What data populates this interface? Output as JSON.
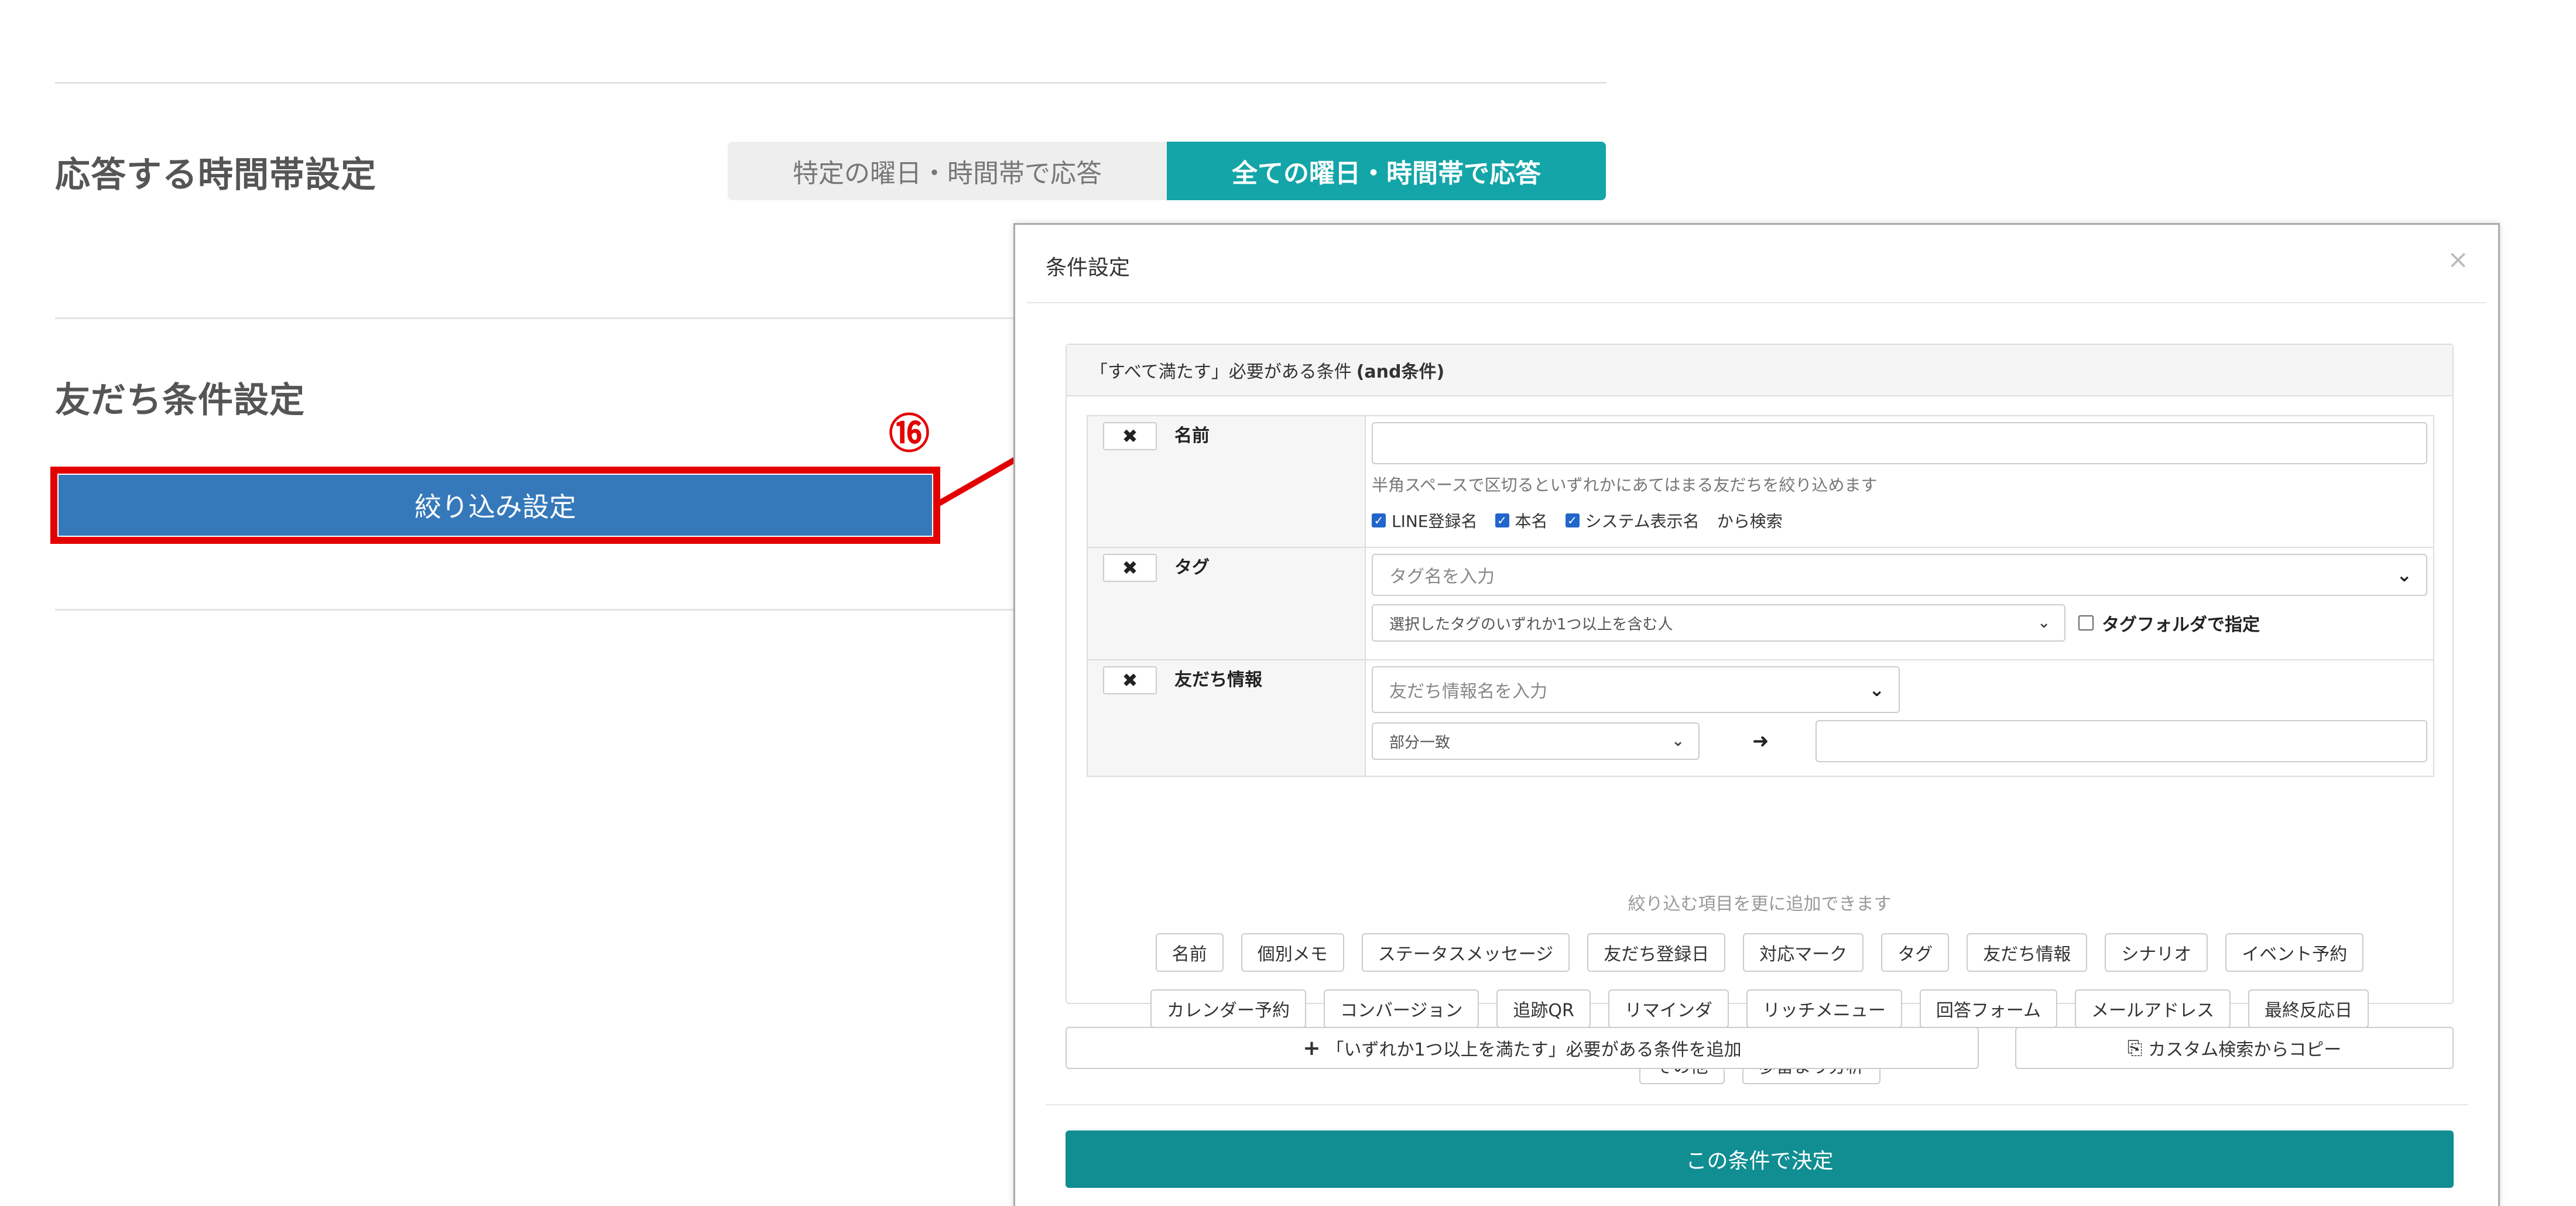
{
  "time_section": {
    "title": "応答する時間帯設定",
    "option_specific": "特定の曜日・時間帯で応答",
    "option_all": "全ての曜日・時間帯で応答"
  },
  "friend_section": {
    "title": "友だち条件設定",
    "filter_button": "絞り込み設定"
  },
  "annotation": {
    "step": "⑯"
  },
  "modal": {
    "title": "条件設定",
    "close": "×",
    "panel_head": "「すべて満たす」必要がある条件",
    "panel_head_bold": "(and条件)",
    "remove_label": "✖",
    "conditions": {
      "name": {
        "label": "名前",
        "input_value": "",
        "hint": "半角スペースで区切るといずれかにあてはまる友だちを絞り込めます",
        "checks": [
          "LINE登録名",
          "本名",
          "システム表示名"
        ],
        "search_suffix": "から検索"
      },
      "tag": {
        "label": "タグ",
        "placeholder": "タグ名を入力",
        "mode": "選択したタグのいずれか1つ以上を含む人",
        "folder_check": "タグフォルダで指定"
      },
      "friend_info": {
        "label": "友だち情報",
        "placeholder": "友だち情報名を入力",
        "match": "部分一致",
        "arrow": "➜",
        "value": ""
      }
    },
    "add_hint": "絞り込む項目を更に追加できます",
    "chips": [
      "名前",
      "個別メモ",
      "ステータスメッセージ",
      "友だち登録日",
      "対応マーク",
      "タグ",
      "友だち情報",
      "シナリオ",
      "イベント予約",
      "カレンダー予約",
      "コンバージョン",
      "追跡QR",
      "リマインダ",
      "リッチメニュー",
      "回答フォーム",
      "メールアドレス",
      "最終反応日",
      "その他",
      "歩留まり分析"
    ],
    "add_or_button": "「いずれか1つ以上を満たす」必要がある条件を追加",
    "copy_button": "カスタム検索からコピー",
    "decide_button": "この条件で決定"
  },
  "colors": {
    "accent": "#13a5a8",
    "primary_button": "#3579ba",
    "highlight": "#e30000",
    "decide": "#108e92"
  }
}
